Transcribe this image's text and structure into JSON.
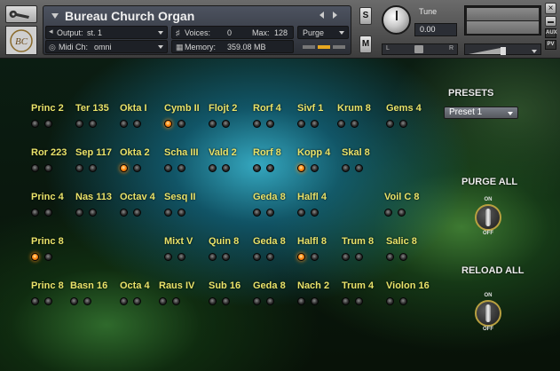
{
  "header": {
    "instrument_title": "Bureau Church Organ",
    "output_label": "Output:",
    "output_value": "st. 1",
    "voices_label": "Voices:",
    "voices_value": "0",
    "max_label": "Max:",
    "max_value": "128",
    "purge_label": "Purge",
    "midi_label": "Midi Ch:",
    "midi_value": "omni",
    "memory_label": "Memory:",
    "memory_value": "359.08 MB",
    "solo_label": "S",
    "mute_label": "M",
    "tune_label": "Tune",
    "tune_value": "0.00",
    "pan_left": "L",
    "pan_right": "R",
    "close_label": "×",
    "aux_label": "AUX",
    "pv_label": "PV",
    "logo_text": "BC"
  },
  "stops": [
    {
      "label": "Princ 2",
      "leds": [
        false,
        false
      ]
    },
    {
      "label": "Ter 135",
      "leds": [
        false,
        false
      ]
    },
    {
      "label": "Okta I",
      "leds": [
        false,
        false
      ]
    },
    {
      "label": "Cymb II",
      "leds": [
        true,
        false
      ]
    },
    {
      "label": "Flojt 2",
      "leds": [
        false,
        false
      ]
    },
    {
      "label": "Rorf 4",
      "leds": [
        false,
        false
      ]
    },
    {
      "label": "Sivf 1",
      "leds": [
        false,
        false
      ]
    },
    {
      "label": "Krum 8",
      "leds": [
        false,
        false
      ]
    },
    {
      "label": "Gems 4",
      "leds": [
        false,
        false
      ]
    },
    {
      "label": "Ror 223",
      "leds": [
        false,
        false
      ]
    },
    {
      "label": "Sep 117",
      "leds": [
        false,
        false
      ]
    },
    {
      "label": "Okta 2",
      "leds": [
        true,
        false
      ]
    },
    {
      "label": "Scha III",
      "leds": [
        false,
        false
      ]
    },
    {
      "label": "Vald 2",
      "leds": [
        false,
        false
      ]
    },
    {
      "label": "Rorf 8",
      "leds": [
        false,
        false
      ]
    },
    {
      "label": "Kopp 4",
      "leds": [
        true,
        false
      ]
    },
    {
      "label": "Skal 8",
      "leds": [
        false,
        false
      ]
    },
    {
      "label": "Princ 4",
      "leds": [
        false,
        false
      ]
    },
    {
      "label": "Nas 113",
      "leds": [
        false,
        false
      ]
    },
    {
      "label": "Octav 4",
      "leds": [
        false,
        false
      ]
    },
    {
      "label": "Sesq II",
      "leds": [
        false,
        false
      ]
    },
    {
      "label": "Geda 8",
      "leds": [
        false,
        false
      ]
    },
    {
      "label": "Halfl 4",
      "leds": [
        false,
        false
      ]
    },
    {
      "label": "Voil C 8",
      "leds": [
        false,
        false
      ]
    },
    {
      "label": "Princ 8",
      "leds": [
        true,
        false
      ]
    },
    {
      "label": "Mixt V",
      "leds": [
        false,
        false
      ]
    },
    {
      "label": "Quin 8",
      "leds": [
        false,
        false
      ]
    },
    {
      "label": "Geda 8",
      "leds": [
        false,
        false
      ]
    },
    {
      "label": "Halfl 8",
      "leds": [
        true,
        false
      ]
    },
    {
      "label": "Trum 8",
      "leds": [
        false,
        false
      ]
    },
    {
      "label": "Salic 8",
      "leds": [
        false,
        false
      ]
    },
    {
      "label": "Princ 8",
      "leds": [
        false,
        false
      ]
    },
    {
      "label": "Basn 16",
      "leds": [
        false,
        false
      ]
    },
    {
      "label": "Octa 4",
      "leds": [
        false,
        false
      ]
    },
    {
      "label": "Raus IV",
      "leds": [
        false,
        false
      ]
    },
    {
      "label": "Sub 16",
      "leds": [
        false,
        false
      ]
    },
    {
      "label": "Geda 8",
      "leds": [
        false,
        false
      ]
    },
    {
      "label": "Nach 2",
      "leds": [
        false,
        false
      ]
    },
    {
      "label": "Trum 4",
      "leds": [
        false,
        false
      ]
    },
    {
      "label": "Violon 16",
      "leds": [
        false,
        false
      ]
    }
  ],
  "controls": {
    "presets_heading": "PRESETS",
    "preset_value": "Preset 1",
    "purge_all_heading": "PURGE ALL",
    "reload_all_heading": "RELOAD ALL",
    "switch_on_label": "ON",
    "switch_off_label": "OFF"
  },
  "colors": {
    "stop_label": "#e9e36a",
    "led_on": "#ff8a12"
  }
}
